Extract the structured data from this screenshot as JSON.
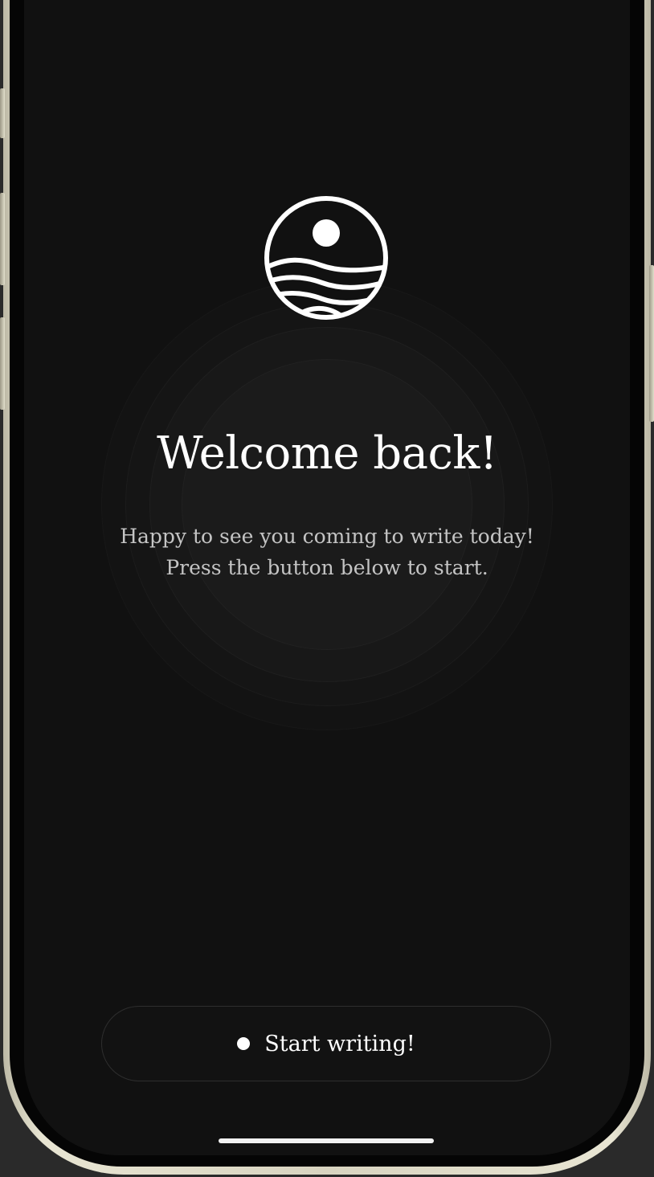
{
  "welcome": {
    "title": "Welcome back!",
    "subtitle_line1": "Happy to see you coming to write today!",
    "subtitle_line2": "Press the button below to start."
  },
  "action": {
    "start_label": "Start writing!"
  },
  "icons": {
    "logo": "sun-over-waves-icon",
    "button_dot": "dot-icon"
  },
  "colors": {
    "background": "#111111",
    "text": "#ffffff",
    "muted_text": "#c4c4c4",
    "frame": "#e8e5d3"
  }
}
